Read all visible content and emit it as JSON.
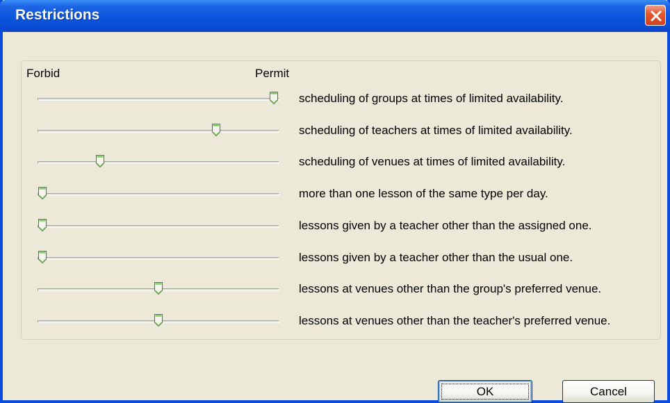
{
  "window": {
    "title": "Restrictions"
  },
  "scale": {
    "min_label": "Forbid",
    "max_label": "Permit"
  },
  "restrictions": [
    {
      "label": "scheduling of groups at times of limited availability.",
      "value": 1.0
    },
    {
      "label": "scheduling of teachers at times of limited availability.",
      "value": 0.75
    },
    {
      "label": "scheduling of venues at times of limited availability.",
      "value": 0.25
    },
    {
      "label": "more than one lesson of the same type per day.",
      "value": 0.0
    },
    {
      "label": "lessons given by a teacher other than the assigned one.",
      "value": 0.0
    },
    {
      "label": "lessons given by a teacher other than the usual one.",
      "value": 0.0
    },
    {
      "label": "lessons at venues other than the group's preferred venue.",
      "value": 0.5
    },
    {
      "label": "lessons at venues other than the teacher's preferred venue.",
      "value": 0.5
    }
  ],
  "buttons": {
    "ok": "OK",
    "cancel": "Cancel"
  }
}
